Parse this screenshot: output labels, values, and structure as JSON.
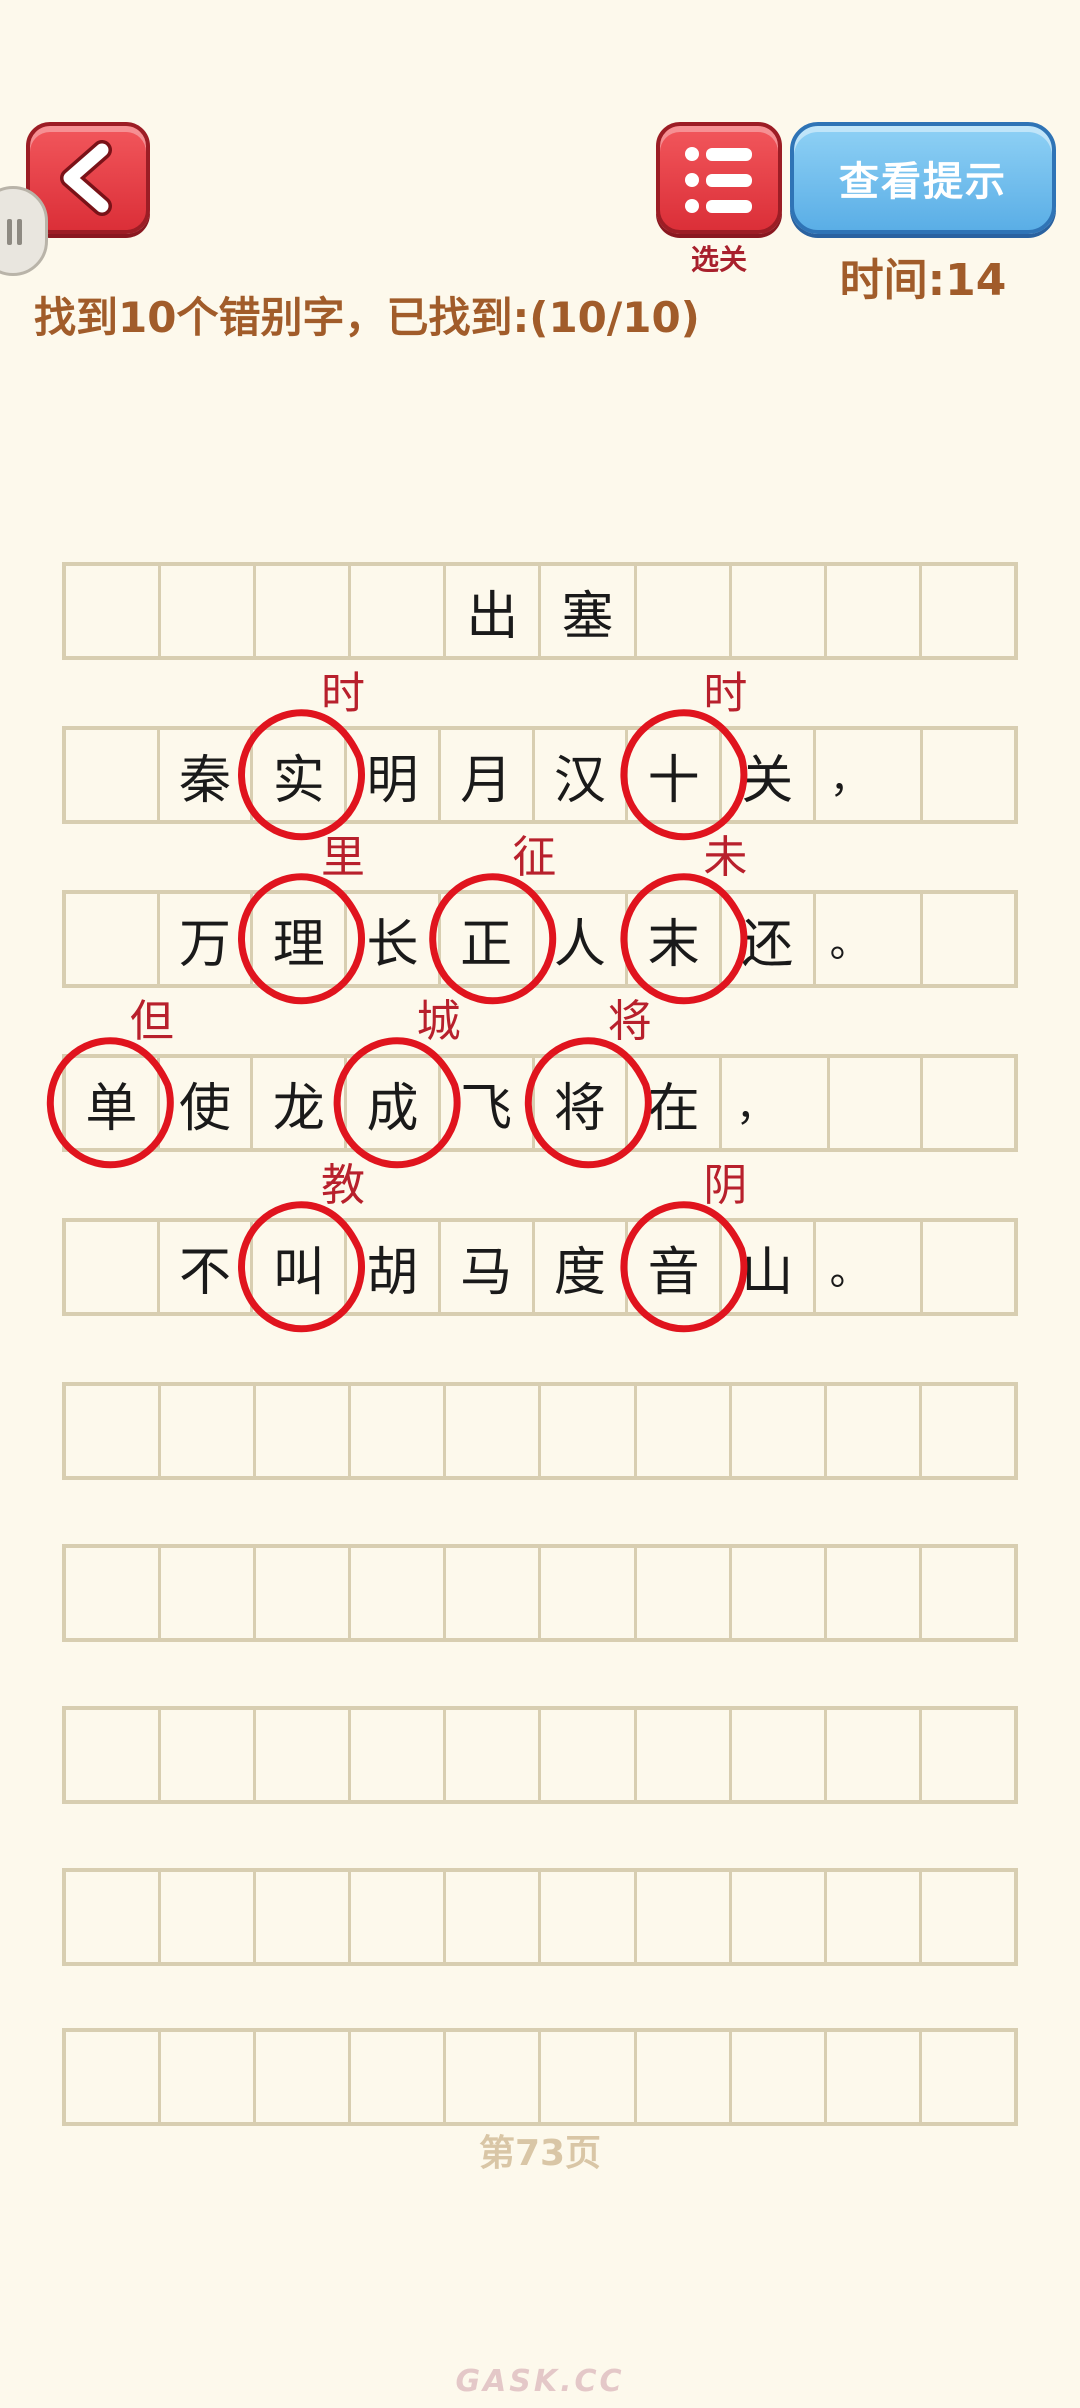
{
  "header": {
    "menu_label": "选关",
    "hint_label": "查看提示",
    "timer": "时间:14"
  },
  "status": "找到10个错别字，已找到:(10/10)",
  "poem": {
    "rows": [
      [
        "",
        "",
        "",
        "",
        "出",
        "塞",
        "",
        "",
        "",
        ""
      ],
      [
        "",
        "秦",
        "实",
        "明",
        "月",
        "汉",
        "十",
        "关",
        "，",
        ""
      ],
      [
        "",
        "万",
        "理",
        "长",
        "正",
        "人",
        "末",
        "还",
        "。",
        ""
      ],
      [
        "单",
        "使",
        "龙",
        "成",
        "飞",
        "将",
        "在",
        "，",
        "",
        ""
      ],
      [
        "",
        "不",
        "叫",
        "胡",
        "马",
        "度",
        "音",
        "山",
        "。",
        ""
      ],
      [
        "",
        "",
        "",
        "",
        "",
        "",
        "",
        "",
        "",
        ""
      ],
      [
        "",
        "",
        "",
        "",
        "",
        "",
        "",
        "",
        "",
        ""
      ],
      [
        "",
        "",
        "",
        "",
        "",
        "",
        "",
        "",
        "",
        ""
      ],
      [
        "",
        "",
        "",
        "",
        "",
        "",
        "",
        "",
        "",
        ""
      ],
      [
        "",
        "",
        "",
        "",
        "",
        "",
        "",
        "",
        "",
        ""
      ]
    ],
    "corrections": [
      {
        "row": 1,
        "col": 2,
        "text": "时"
      },
      {
        "row": 1,
        "col": 6,
        "text": "时"
      },
      {
        "row": 2,
        "col": 2,
        "text": "里"
      },
      {
        "row": 2,
        "col": 4,
        "text": "征"
      },
      {
        "row": 2,
        "col": 6,
        "text": "未"
      },
      {
        "row": 3,
        "col": 0,
        "text": "但"
      },
      {
        "row": 3,
        "col": 3,
        "text": "城"
      },
      {
        "row": 3,
        "col": 5,
        "text": "将"
      },
      {
        "row": 4,
        "col": 2,
        "text": "教"
      },
      {
        "row": 4,
        "col": 6,
        "text": "阴"
      }
    ]
  },
  "page_number": "第73页",
  "watermark": "GASK.CC",
  "colors": {
    "background": "#fdf9ec",
    "grid_line": "#d8ceb1",
    "mark_red": "#e0141e",
    "correction_text": "#b8202c",
    "accent_brown": "#a15c2a",
    "hint_blue": "#5aaee6"
  }
}
